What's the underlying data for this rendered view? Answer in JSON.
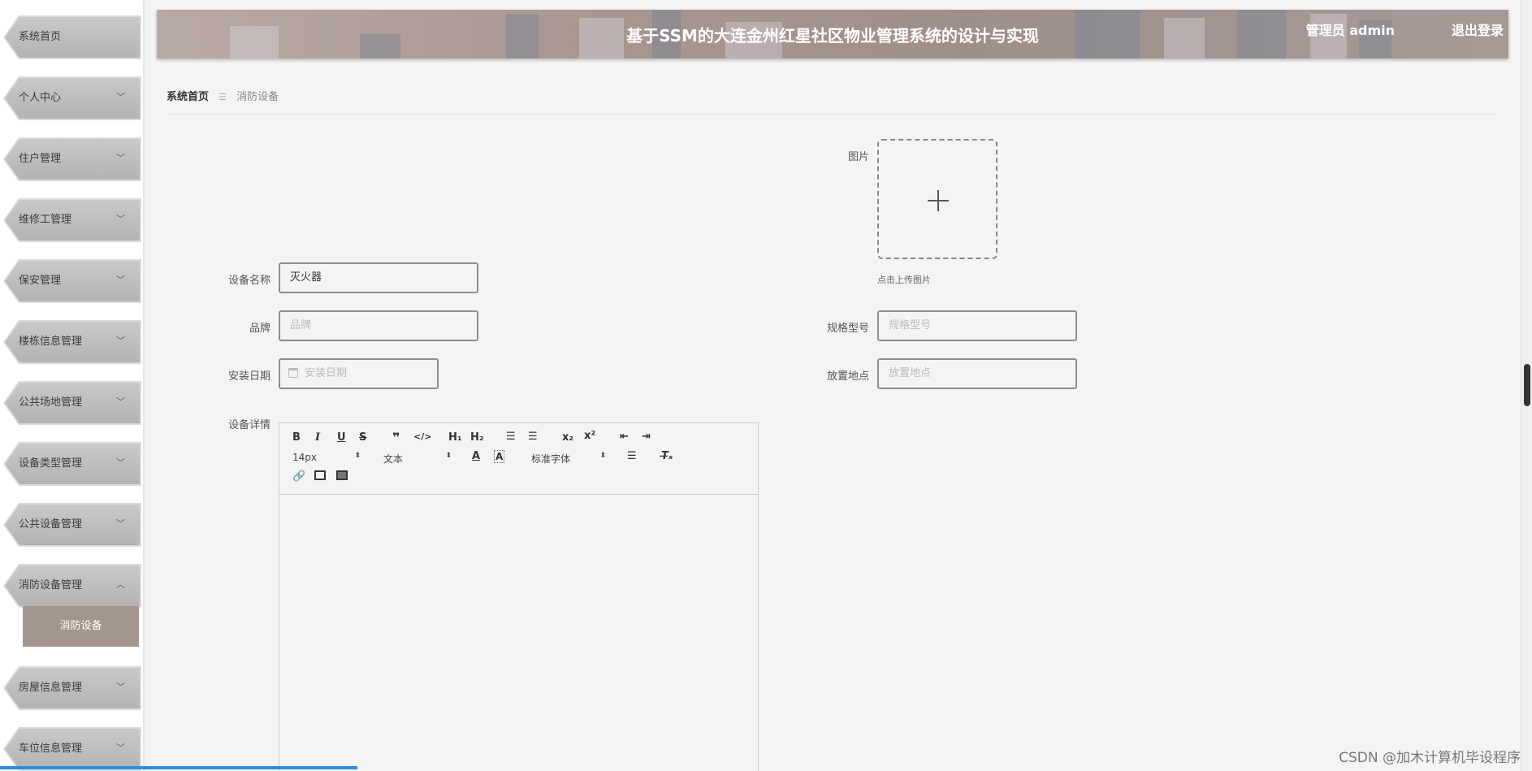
{
  "header": {
    "title": "基于SSM的大连金州红星社区物业管理系统的设计与实现",
    "user_label": "管理员 admin",
    "logout_label": "退出登录"
  },
  "sidebar": {
    "items": [
      {
        "label": "系统首页",
        "has_chevron": false
      },
      {
        "label": "个人中心",
        "has_chevron": true
      },
      {
        "label": "住户管理",
        "has_chevron": true
      },
      {
        "label": "维修工管理",
        "has_chevron": true
      },
      {
        "label": "保安管理",
        "has_chevron": true
      },
      {
        "label": "楼栋信息管理",
        "has_chevron": true
      },
      {
        "label": "公共场地管理",
        "has_chevron": true
      },
      {
        "label": "设备类型管理",
        "has_chevron": true
      },
      {
        "label": "公共设备管理",
        "has_chevron": true
      },
      {
        "label": "消防设备管理",
        "has_chevron": true,
        "expanded": true
      },
      {
        "label": "房屋信息管理",
        "has_chevron": true
      },
      {
        "label": "车位信息管理",
        "has_chevron": true
      }
    ],
    "submenu": {
      "label": "消防设备"
    }
  },
  "breadcrumb": {
    "home": "系统首页",
    "separator": "☰",
    "current": "消防设备"
  },
  "form": {
    "image": {
      "label": "图片",
      "hint": "点击上传图片"
    },
    "device_name": {
      "label": "设备名称",
      "value": "灭火器"
    },
    "brand": {
      "label": "品牌",
      "placeholder": "品牌"
    },
    "spec": {
      "label": "规格型号",
      "placeholder": "规格型号"
    },
    "install_date": {
      "label": "安装日期",
      "placeholder": "安装日期"
    },
    "location": {
      "label": "放置地点",
      "placeholder": "放置地点"
    },
    "details": {
      "label": "设备详情"
    }
  },
  "editor": {
    "font_size": "14px",
    "text_style": "文本",
    "font_family": "标准字体"
  },
  "watermark": "CSDN @加木计算机毕设程序"
}
